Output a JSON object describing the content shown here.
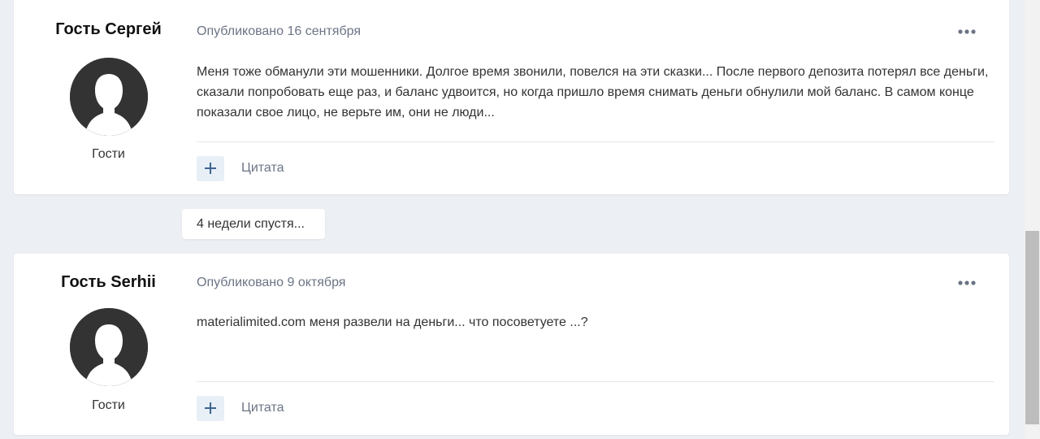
{
  "posts": [
    {
      "author": "Гость Сергей",
      "role": "Гости",
      "published": "Опубликовано 16 сентября",
      "body": "Меня тоже обманули эти мошенники. Долгое время звонили, повелся на эти сказки... После первого депозита потерял все деньги, сказали попробовать еще раз, и баланс удвоится, но когда пришло время снимать деньги обнулили мой баланс. В самом конце показали свое лицо, не верьте им, они не люди...",
      "quote_label": "Цитата",
      "avatar_icon": "user-silhouette-icon",
      "more_icon": "more-horizontal-icon"
    },
    {
      "author": "Гость Serhii",
      "role": "Гости",
      "published": "Опубликовано 9 октября",
      "body": "materialimited.com меня развели на деньги... что посоветуете ...?",
      "quote_label": "Цитата",
      "avatar_icon": "user-silhouette-icon",
      "more_icon": "more-horizontal-icon"
    }
  ],
  "time_gap": "4 недели спустя...",
  "colors": {
    "background": "#eceff4",
    "card": "#ffffff",
    "meta_text": "#6b7485",
    "body_text": "#333333",
    "accent": "#3d6594",
    "plus_button_bg": "#e8eff6",
    "avatar_bg": "#333333"
  }
}
